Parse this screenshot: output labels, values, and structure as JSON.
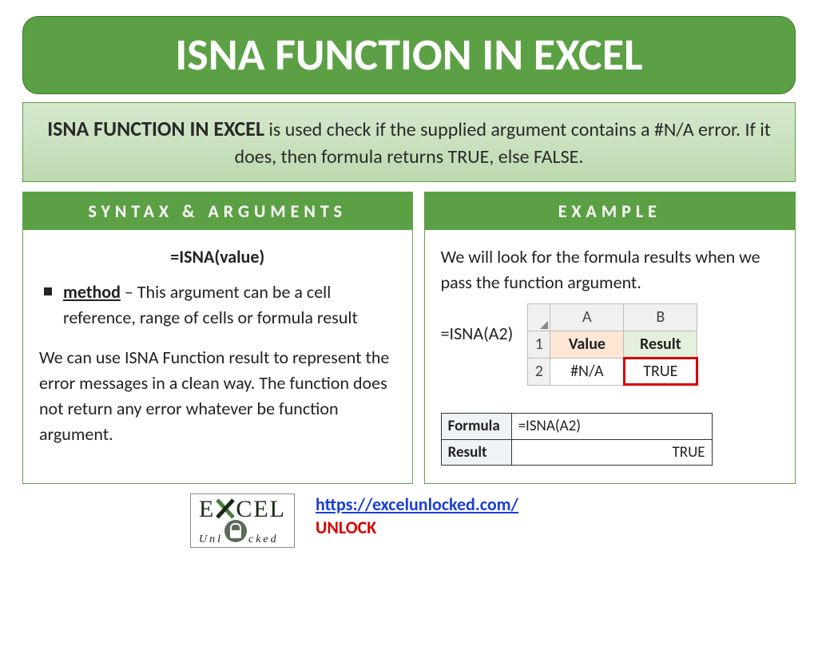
{
  "title": "ISNA FUNCTION IN EXCEL",
  "description": {
    "bold_lead": "ISNA FUNCTION IN EXCEL",
    "rest": " is used check if the supplied argument contains a #N/A error. If it does, then formula returns TRUE, else FALSE."
  },
  "left_panel": {
    "header": "SYNTAX & ARGUMENTS",
    "formula": "=ISNA(value)",
    "bullet_label": "method",
    "bullet_rest": " – This argument can be a cell reference, range of cells or formula result",
    "paragraph": "We can use ISNA Function result to represent the error messages in a clean way. The function does not return any error whatever be function argument."
  },
  "right_panel": {
    "header": "EXAMPLE",
    "intro": "We will look for the formula results when we pass the function argument.",
    "formula_left": "=ISNA(A2)",
    "sheet": {
      "col_a": "A",
      "col_b": "B",
      "row1": "1",
      "row2": "2",
      "h_value": "Value",
      "h_result": "Result",
      "cell_a2": "#N/A",
      "cell_b2": "TRUE"
    },
    "result_table": {
      "formula_label": "Formula",
      "formula_value": "=ISNA(A2)",
      "result_label": "Result",
      "result_value": "TRUE"
    }
  },
  "footer": {
    "logo_top_1": "E",
    "logo_top_2": "CEL",
    "logo_bottom": "Unl   cked",
    "url": "https://excelunlocked.com/",
    "unlock": "UNLOCK"
  }
}
